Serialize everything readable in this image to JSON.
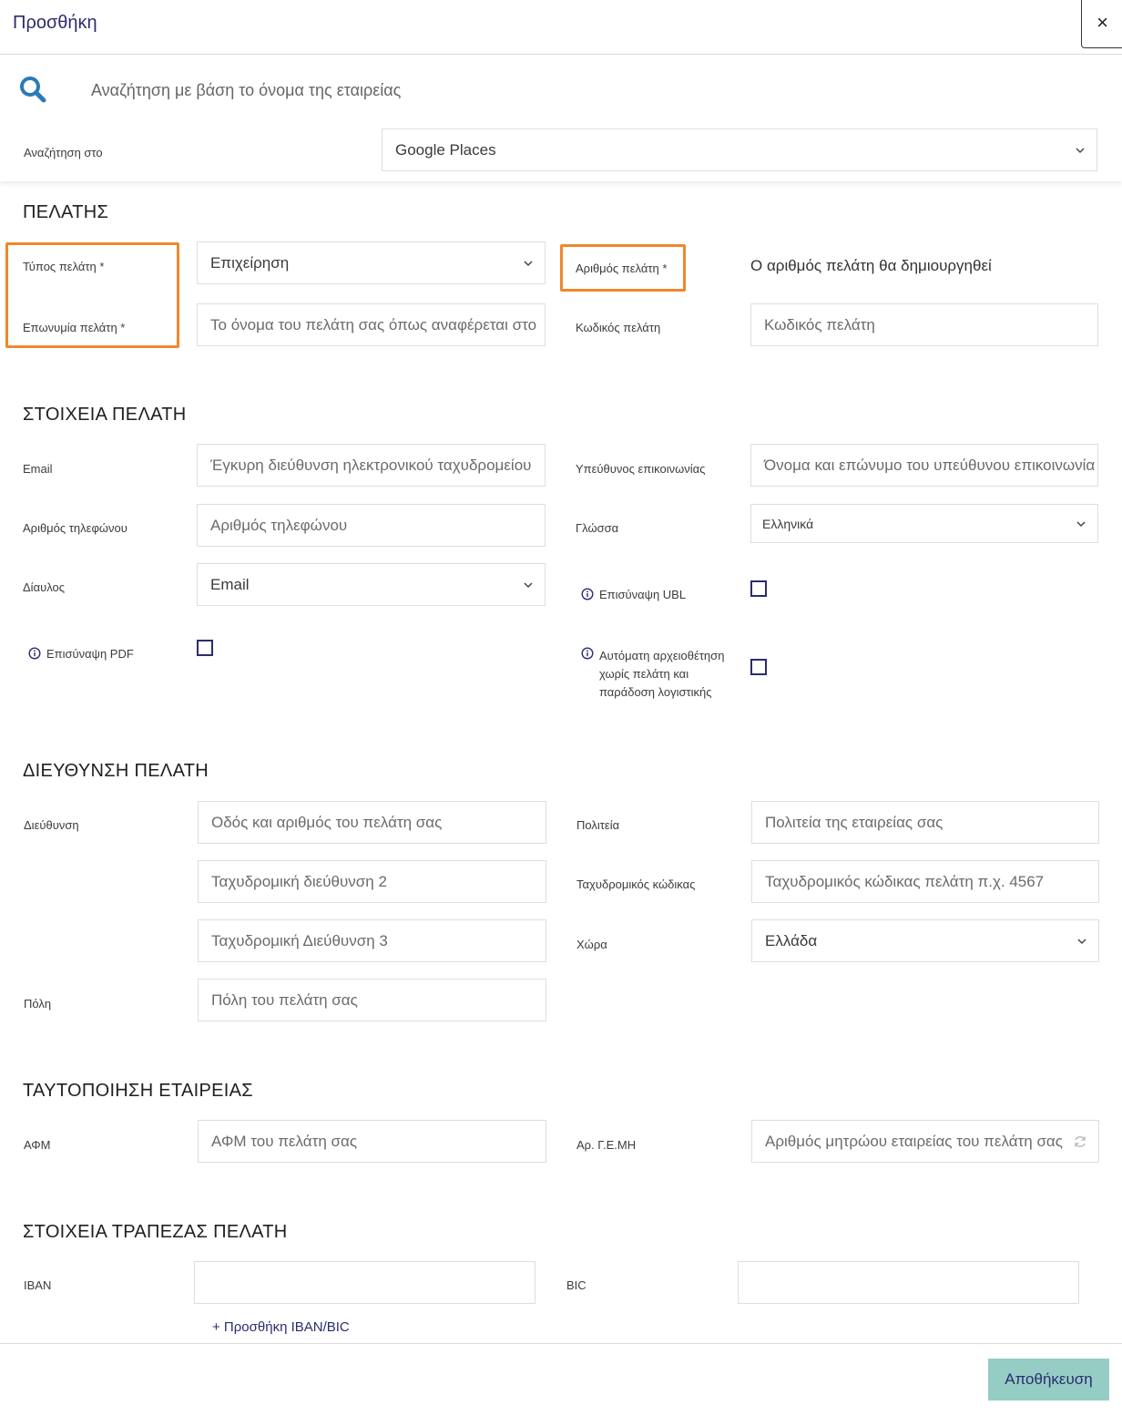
{
  "modal": {
    "title": "Προσθήκη",
    "close_label": "×"
  },
  "search": {
    "placeholder": "Αναζήτηση με βάση το όνομα της εταιρείας",
    "source_label": "Αναζήτηση στο",
    "source_value": "Google Places"
  },
  "customer": {
    "section_title": "ΠΕΛΑΤΗΣ",
    "type_label": "Τύπος πελάτη *",
    "type_value": "Επιχείρηση",
    "name_label": "Επωνυμία πελάτη *",
    "name_placeholder": "Το όνομα του πελάτη σας όπως αναφέρεται στο",
    "number_label": "Αριθμός πελάτη *",
    "number_value": "Ο αριθμός πελάτη θα δημιουργηθεί",
    "code_label": "Κωδικός πελάτη",
    "code_placeholder": "Κωδικός πελάτη"
  },
  "details": {
    "section_title": "ΣΤΟΙΧΕΙΑ ΠΕΛΑΤΗ",
    "email_label": "Email",
    "email_placeholder": "Έγκυρη διεύθυνση ηλεκτρονικού ταχυδρομείου",
    "contact_label": "Υπεύθυνος επικοινωνίας",
    "contact_placeholder": "Όνομα και επώνυμο του υπεύθυνου επικοινωνία",
    "phone_label": "Αριθμός τηλεφώνου",
    "phone_placeholder": "Αριθμός τηλεφώνου",
    "language_label": "Γλώσσα",
    "language_value": "Ελληνικά",
    "channel_label": "Δίαυλος",
    "channel_value": "Email",
    "ubl_label": "Επισύναψη UBL",
    "pdf_label": "Επισύναψη PDF",
    "auto_archive_line1": "Αυτόματη αρχειοθέτηση",
    "auto_archive_line2": "χωρίς πελάτη και",
    "auto_archive_line3": "παράδοση λογιστικής"
  },
  "address": {
    "section_title": "ΔΙΕΥΘΥΝΣΗ ΠΕΛΑΤΗ",
    "address_label": "Διεύθυνση",
    "street_placeholder": "Οδός και αριθμός του πελάτη σας",
    "address2_placeholder": "Ταχυδρομική διεύθυνση 2",
    "address3_placeholder": "Ταχυδρομική Διεύθυνση 3",
    "city_label": "Πόλη",
    "city_placeholder": "Πόλη του πελάτη σας",
    "state_label": "Πολιτεία",
    "state_placeholder": "Πολιτεία της εταιρείας σας",
    "postal_label": "Ταχυδρομικός κώδικας",
    "postal_placeholder": "Ταχυδρομικός κώδικας πελάτη π.χ. 4567",
    "country_label": "Χώρα",
    "country_value": "Ελλάδα"
  },
  "identification": {
    "section_title": "ΤΑΥΤΟΠΟΙΗΣΗ ΕΤΑΙΡΕΙΑΣ",
    "vat_label": "ΑΦΜ",
    "vat_placeholder": "ΑΦΜ του πελάτη σας",
    "gemi_label": "Αρ. Γ.Ε.ΜΗ",
    "gemi_placeholder": "Αριθμός μητρώου εταιρείας του πελάτη σας"
  },
  "bank": {
    "section_title": "ΣΤΟΙΧΕΙΑ ΤΡΑΠΕΖΑΣ ΠΕΛΑΤΗ",
    "iban_label": "IBAN",
    "bic_label": "BIC",
    "add_label": "+ Προσθήκη IBAN/BIC"
  },
  "footer": {
    "save_label": "Αποθήκευση"
  },
  "colors": {
    "accent": "#2b2c6e",
    "save_bg": "#95cdc5",
    "highlight": "#f0872d",
    "search_icon": "#2a7ab8"
  }
}
